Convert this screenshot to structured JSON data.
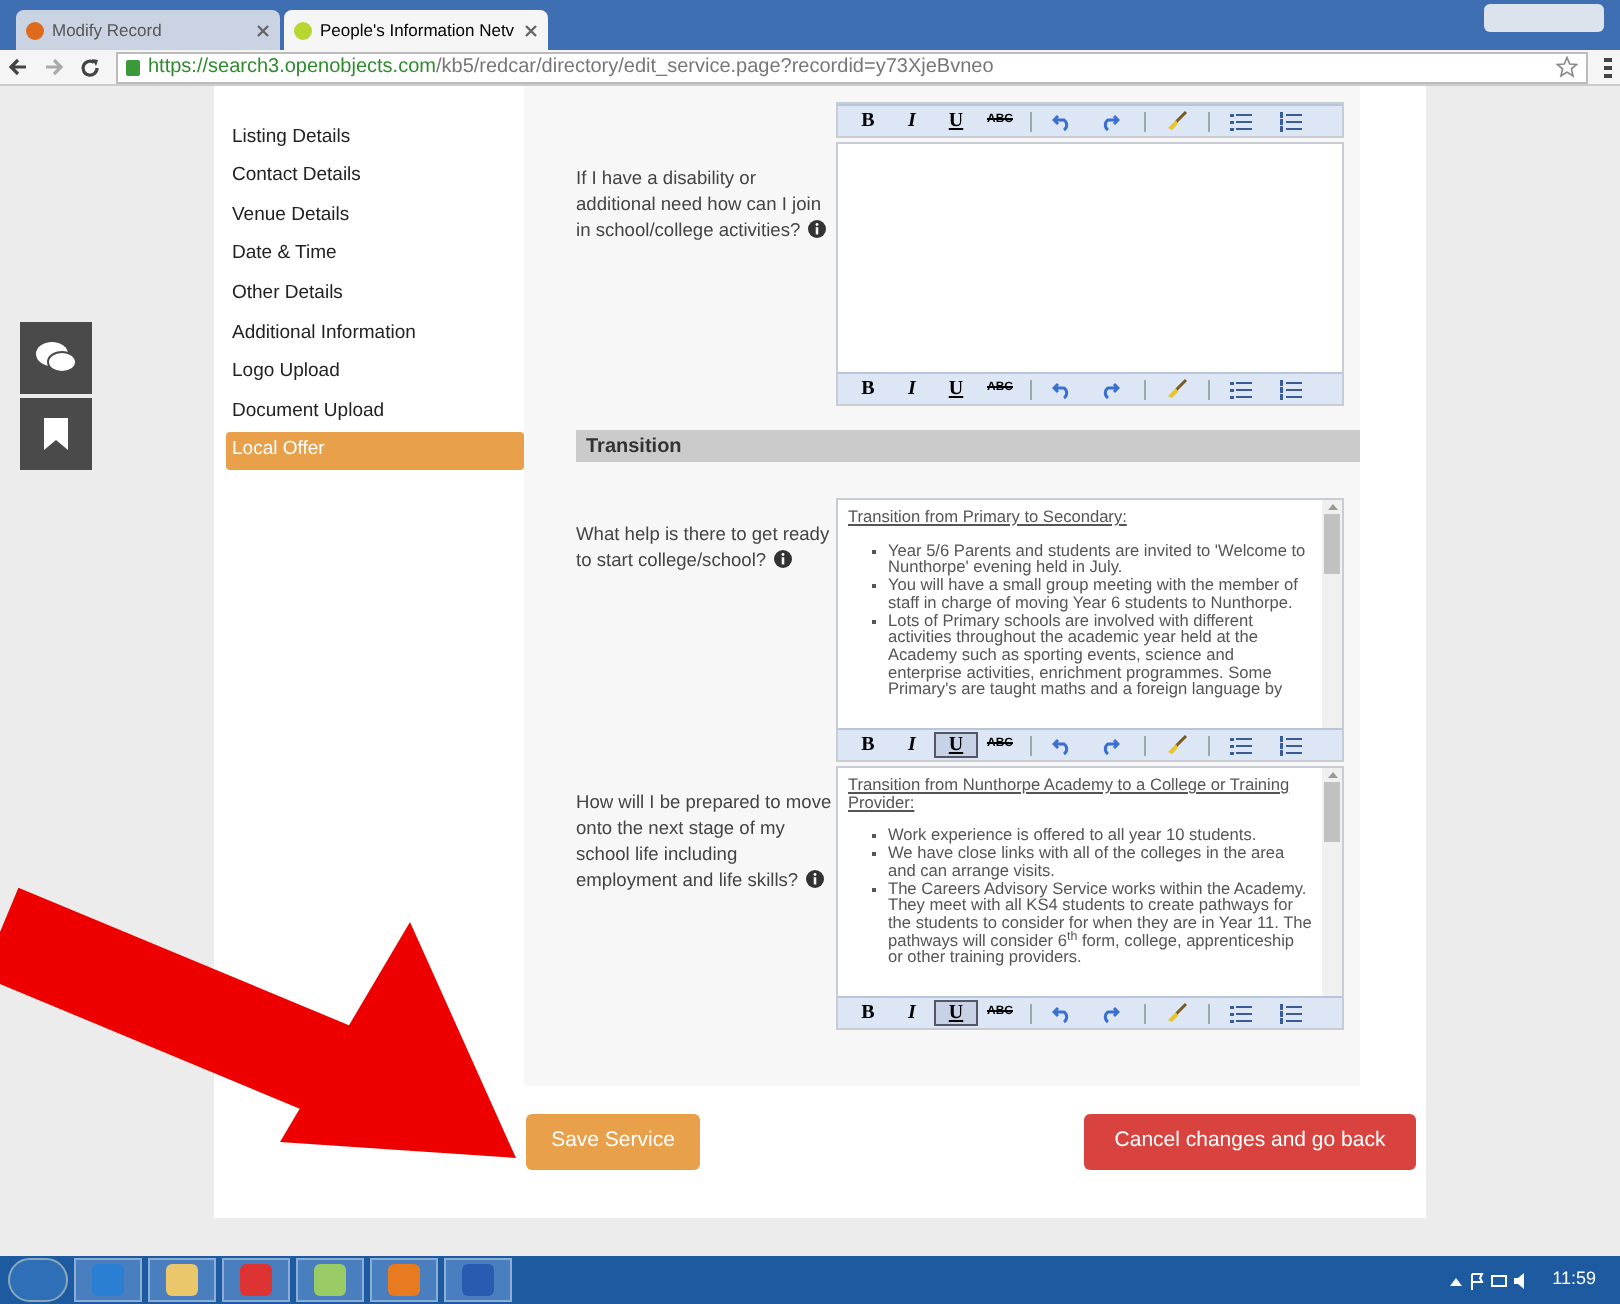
{
  "browser": {
    "tabs": [
      {
        "title": "Modify Record",
        "selected": false
      },
      {
        "title": "People's Information Netv",
        "selected": true
      }
    ],
    "url_host": "https://search3.openobjects.com",
    "url_path": "/kb5/redcar/directory/edit_service.page?recordid=y73XjeBvneo"
  },
  "sidebar": {
    "items": [
      {
        "label": "Listing Details",
        "selected": false
      },
      {
        "label": "Contact Details",
        "selected": false
      },
      {
        "label": "Venue Details",
        "selected": false
      },
      {
        "label": "Date & Time",
        "selected": false
      },
      {
        "label": "Other Details",
        "selected": false
      },
      {
        "label": "Additional Information",
        "selected": false
      },
      {
        "label": "Logo Upload",
        "selected": false
      },
      {
        "label": "Document Upload",
        "selected": false
      },
      {
        "label": "Local Offer",
        "selected": true
      }
    ]
  },
  "fields": [
    {
      "kind": "editor",
      "toolbar_labels": [
        "B",
        "I",
        "U",
        "ABC"
      ],
      "underline_active": false,
      "partial": true
    },
    {
      "kind": "editor",
      "label": "If I have a disability or additional need how can I join in school/college activities?",
      "toolbar_labels": [
        "B",
        "I",
        "U",
        "ABC"
      ],
      "underline_active": false,
      "partial": false
    },
    {
      "kind": "section",
      "label": "Transition"
    },
    {
      "kind": "editor",
      "label": "What help is there to get ready to start college/school?",
      "heading": "Transition from Primary to Secondary:",
      "items": [
        "Year 5/6 Parents and students are invited to 'Welcome to Nunthorpe' evening held in July.",
        "You will have a small group meeting with the member of staff in charge of moving Year 6 students to Nunthorpe.",
        "Lots of Primary schools are involved with different activities throughout the academic year held at the Academy such as sporting events, science and enterprise activities, enrichment programmes. Some Primary's are taught maths and a foreign language by"
      ],
      "toolbar_labels": [
        "B",
        "I",
        "U",
        "ABC"
      ],
      "underline_active": true,
      "partial": false
    },
    {
      "kind": "editor",
      "label": "How will I be prepared to move onto the next stage of my school life including employment and life skills?",
      "heading": "Transition from Nunthorpe Academy to a College or Training Provider:",
      "items": [
        "Work experience is offered to all year 10 students.",
        "We have close links with all of the colleges in the area and can arrange visits.",
        "The Careers Advisory Service works within the Academy. They meet with all KS4 students to create pathways for the students to consider for when they are in Year 11. The pathways will consider 6$^{th}$ form, college, apprenticeship or other training providers."
      ],
      "toolbar_labels": [
        "B",
        "I",
        "U",
        "ABC"
      ],
      "underline_active": true,
      "partial": false
    }
  ],
  "buttons": {
    "save": "Save Service",
    "cancel": "Cancel changes and go back"
  },
  "taskbar": {
    "time": "11:59"
  }
}
